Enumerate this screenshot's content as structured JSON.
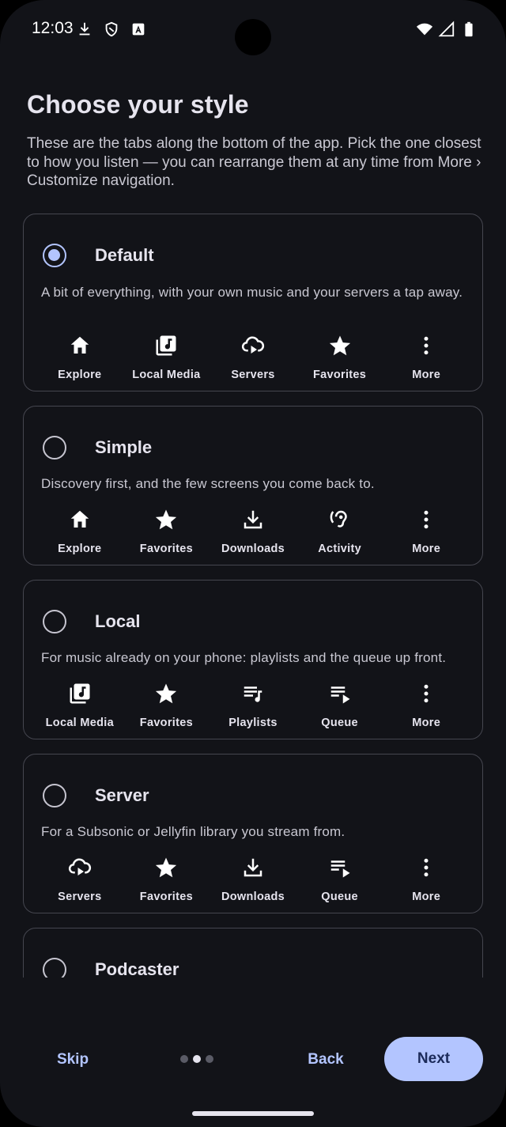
{
  "status_bar": {
    "time": "12:03",
    "left_icons": [
      "download-icon",
      "shield-icon",
      "font-a-icon"
    ],
    "right_icons": [
      "wifi-icon",
      "signal-icon",
      "battery-icon"
    ]
  },
  "header": {
    "title": "Choose your style",
    "description": "These are the tabs along the bottom of the app. Pick the one closest to how you listen — you can rearrange them at any time from More › Customize navigation."
  },
  "options": [
    {
      "title": "Default",
      "selected": true,
      "description": "A bit of everything, with your own music and your servers a tap away.",
      "tabs": [
        {
          "label": "Explore",
          "icon": "home-icon"
        },
        {
          "label": "Local Media",
          "icon": "music-library-icon"
        },
        {
          "label": "Servers",
          "icon": "cloud-play-icon"
        },
        {
          "label": "Favorites",
          "icon": "star-icon"
        },
        {
          "label": "More",
          "icon": "more-vert-icon"
        }
      ]
    },
    {
      "title": "Simple",
      "selected": false,
      "description": "Discovery first, and the few screens you come back to.",
      "tabs": [
        {
          "label": "Explore",
          "icon": "home-icon"
        },
        {
          "label": "Favorites",
          "icon": "star-icon"
        },
        {
          "label": "Downloads",
          "icon": "download-icon"
        },
        {
          "label": "Activity",
          "icon": "hearing-icon"
        },
        {
          "label": "More",
          "icon": "more-vert-icon"
        }
      ]
    },
    {
      "title": "Local",
      "selected": false,
      "description": "For music already on your phone: playlists and the queue up front.",
      "tabs": [
        {
          "label": "Local Media",
          "icon": "music-library-icon"
        },
        {
          "label": "Favorites",
          "icon": "star-icon"
        },
        {
          "label": "Playlists",
          "icon": "playlist-icon"
        },
        {
          "label": "Queue",
          "icon": "queue-icon"
        },
        {
          "label": "More",
          "icon": "more-vert-icon"
        }
      ]
    },
    {
      "title": "Server",
      "selected": false,
      "description": "For a Subsonic or Jellyfin library you stream from.",
      "tabs": [
        {
          "label": "Servers",
          "icon": "cloud-play-icon"
        },
        {
          "label": "Favorites",
          "icon": "star-icon"
        },
        {
          "label": "Downloads",
          "icon": "download-icon"
        },
        {
          "label": "Queue",
          "icon": "queue-icon"
        },
        {
          "label": "More",
          "icon": "more-vert-icon"
        }
      ]
    },
    {
      "title": "Podcaster",
      "selected": false,
      "description": "",
      "tabs": []
    }
  ],
  "footer": {
    "skip_label": "Skip",
    "back_label": "Back",
    "next_label": "Next",
    "page_indicator": {
      "total": 3,
      "current": 2
    }
  },
  "colors": {
    "background": "#121318",
    "accent": "#b3c5ff",
    "on_accent": "#1c2b5a",
    "outline": "#45464f",
    "text_primary": "#e6e4ee",
    "text_secondary": "#c9c8d2"
  }
}
